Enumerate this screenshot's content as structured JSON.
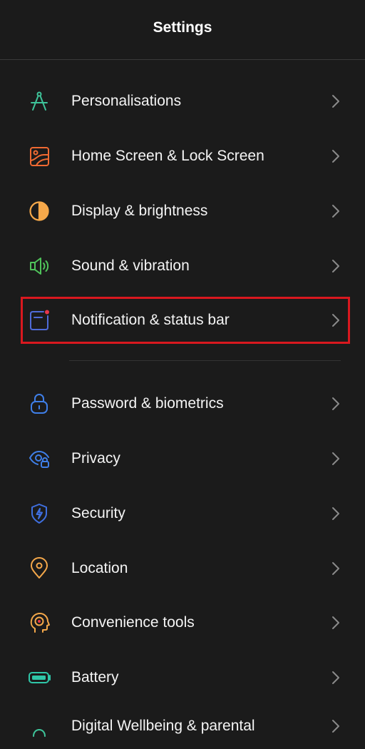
{
  "header": {
    "title": "Settings"
  },
  "items": [
    {
      "label": "Personalisations",
      "icon": "compass-icon",
      "color": "#3ec49a"
    },
    {
      "label": "Home Screen & Lock Screen",
      "icon": "image-icon",
      "color": "#f06a32"
    },
    {
      "label": "Display & brightness",
      "icon": "contrast-icon",
      "color": "#f5a84a"
    },
    {
      "label": "Sound & vibration",
      "icon": "speaker-icon",
      "color": "#4fc25a"
    },
    {
      "label": "Notification & status bar",
      "icon": "notification-icon",
      "color": "#4f6bd8"
    },
    {
      "label": "Password & biometrics",
      "icon": "lock-icon",
      "color": "#3f7fe8"
    },
    {
      "label": "Privacy",
      "icon": "eye-lock-icon",
      "color": "#3f7fe8"
    },
    {
      "label": "Security",
      "icon": "shield-icon",
      "color": "#3f6fe0"
    },
    {
      "label": "Location",
      "icon": "location-pin-icon",
      "color": "#f5a84a"
    },
    {
      "label": "Convenience tools",
      "icon": "head-gear-icon",
      "color": "#f5a84a"
    },
    {
      "label": "Battery",
      "icon": "battery-icon",
      "color": "#2fc6a8"
    },
    {
      "label": "Digital Wellbeing & parental",
      "icon": "wellbeing-icon",
      "color": "#3ec49a"
    }
  ],
  "highlighted_item": "Notification & status bar",
  "highlight_color": "#d9181f"
}
